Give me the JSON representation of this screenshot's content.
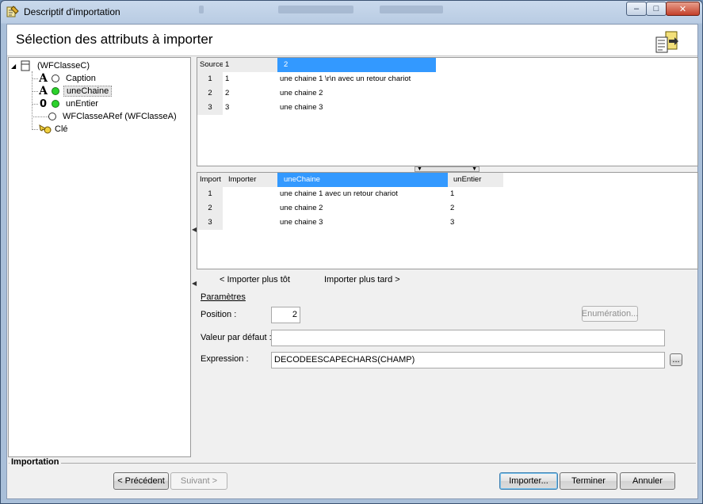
{
  "window": {
    "title": "Descriptif d'importation"
  },
  "header": {
    "title": "Sélection des attributs à importer"
  },
  "tree": {
    "root": "(WFClasseC)",
    "items": [
      {
        "glyph": "A",
        "label": "Caption",
        "active": false
      },
      {
        "glyph": "A",
        "label": "uneChaine",
        "active": true,
        "selected": true
      },
      {
        "glyph": "0",
        "label": "unEntier",
        "active": true
      },
      {
        "glyph": "",
        "label": "WFClasseARef (WFClasseA)",
        "active": false
      },
      {
        "glyph": "key",
        "label": "Clé",
        "active": false
      }
    ]
  },
  "source_grid": {
    "corner": "Source",
    "columns": [
      "1",
      "2"
    ],
    "rows": [
      {
        "num": "1",
        "cells": [
          "1",
          "une chaine 1 \\r\\n avec un retour chariot"
        ]
      },
      {
        "num": "2",
        "cells": [
          "2",
          "une chaine 2"
        ]
      },
      {
        "num": "3",
        "cells": [
          "3",
          "une chaine 3"
        ]
      }
    ]
  },
  "import_grid": {
    "corner": "Import",
    "columns": [
      "Importer",
      "uneChaine",
      "unEntier"
    ],
    "rows": [
      {
        "num": "1",
        "cells": [
          "",
          "une chaine 1  avec un retour chariot",
          "1"
        ]
      },
      {
        "num": "2",
        "cells": [
          "",
          "une chaine 2",
          "2"
        ]
      },
      {
        "num": "3",
        "cells": [
          "",
          "une chaine 3",
          "3"
        ]
      }
    ]
  },
  "order": {
    "earlier": "< Importer plus tôt",
    "later": "Importer plus tard >"
  },
  "params": {
    "section": "Paramètres",
    "position_label": "Position :",
    "position_value": "2",
    "enum_button": "Enumération...",
    "default_label": "Valeur par défaut :",
    "default_value": "",
    "expression_label": "Expression :",
    "expression_value": "DECODEESCAPECHARS(CHAMP)",
    "ellipsis": "..."
  },
  "footer": {
    "group_label": "Importation",
    "prev": "< Précédent",
    "next": "Suivant >",
    "import": "Importer...",
    "finish": "Terminer",
    "cancel": "Annuler"
  },
  "colors": {
    "selection": "#3399ff",
    "active_dot": "#2bd22b"
  }
}
